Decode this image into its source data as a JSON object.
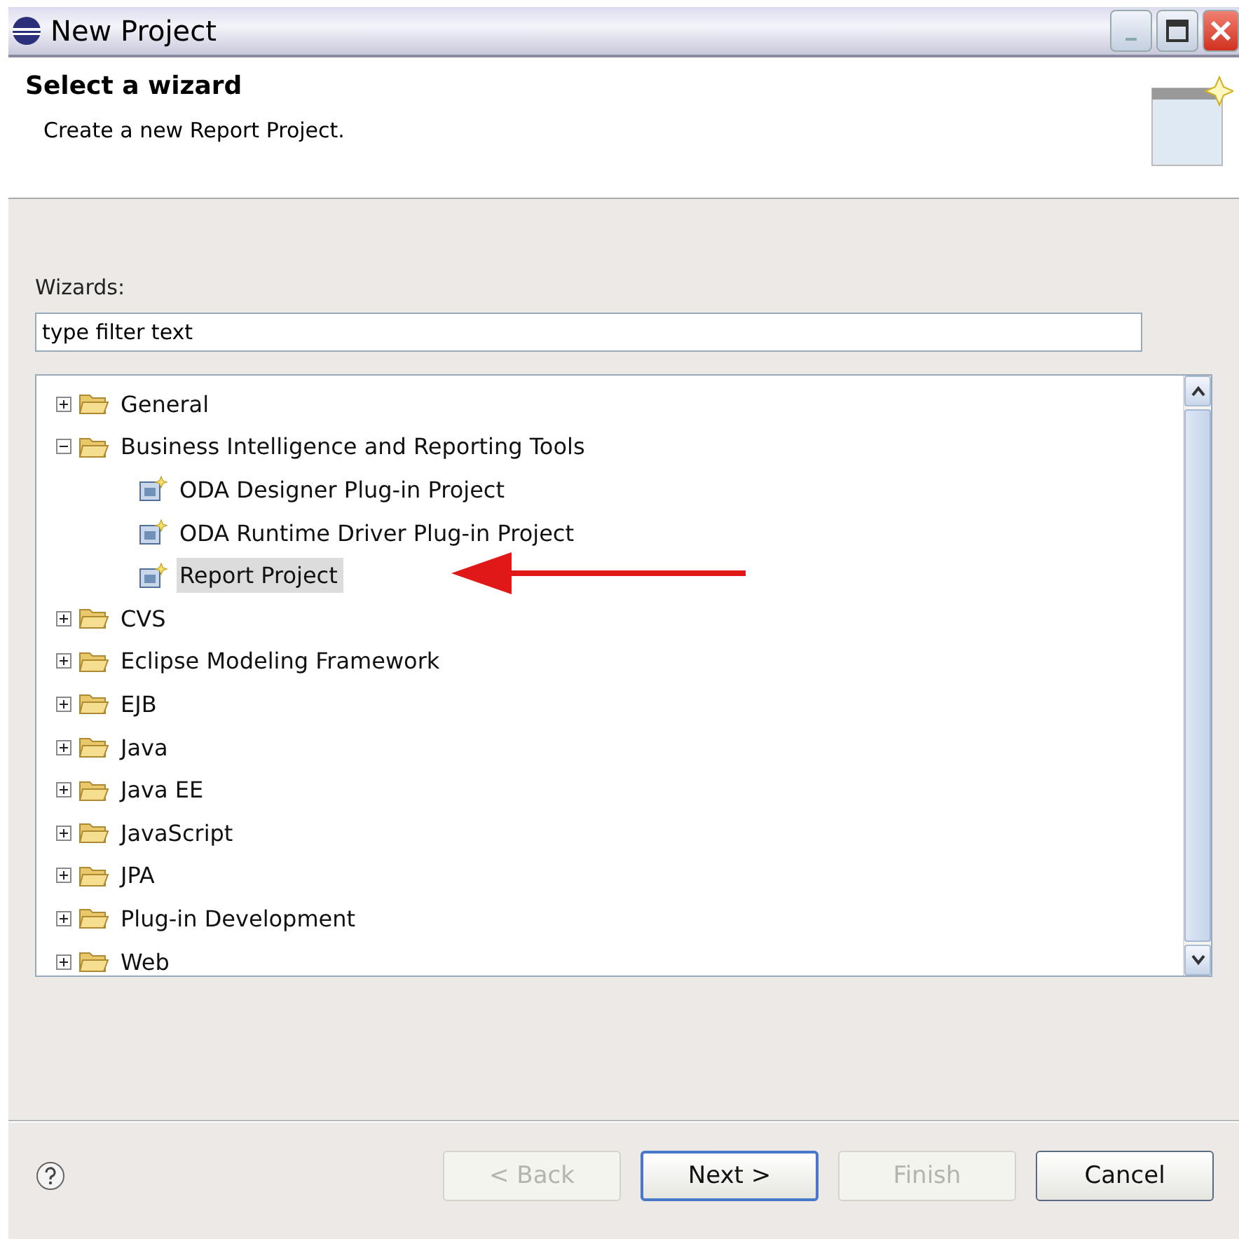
{
  "window": {
    "title": "New Project"
  },
  "header": {
    "title": "Select a wizard",
    "description": "Create a new Report Project."
  },
  "filter": {
    "label": "Wizards:",
    "value": "type filter text"
  },
  "tree": [
    {
      "label": "General",
      "kind": "folder",
      "expanded": false,
      "selected": false
    },
    {
      "label": "Business Intelligence and Reporting Tools",
      "kind": "folder",
      "expanded": true,
      "selected": false,
      "children": [
        {
          "label": "ODA Designer Plug-in Project",
          "kind": "project",
          "selected": false
        },
        {
          "label": "ODA Runtime Driver Plug-in Project",
          "kind": "project",
          "selected": false
        },
        {
          "label": "Report Project",
          "kind": "project",
          "selected": true
        }
      ]
    },
    {
      "label": "CVS",
      "kind": "folder",
      "expanded": false,
      "selected": false
    },
    {
      "label": "Eclipse Modeling Framework",
      "kind": "folder",
      "expanded": false,
      "selected": false
    },
    {
      "label": "EJB",
      "kind": "folder",
      "expanded": false,
      "selected": false
    },
    {
      "label": "Java",
      "kind": "folder",
      "expanded": false,
      "selected": false
    },
    {
      "label": "Java EE",
      "kind": "folder",
      "expanded": false,
      "selected": false
    },
    {
      "label": "JavaScript",
      "kind": "folder",
      "expanded": false,
      "selected": false
    },
    {
      "label": "JPA",
      "kind": "folder",
      "expanded": false,
      "selected": false
    },
    {
      "label": "Plug-in Development",
      "kind": "folder",
      "expanded": false,
      "selected": false
    },
    {
      "label": "Web",
      "kind": "folder",
      "expanded": false,
      "selected": false
    }
  ],
  "buttons": [
    {
      "label": "< Back",
      "disabled": true,
      "default": false
    },
    {
      "label": "Next >",
      "disabled": false,
      "default": true
    },
    {
      "label": "Finish",
      "disabled": true,
      "default": false
    },
    {
      "label": "Cancel",
      "disabled": false,
      "default": false
    }
  ]
}
